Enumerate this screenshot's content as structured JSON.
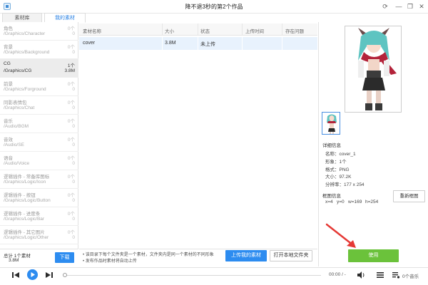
{
  "window": {
    "title": "降不退3秒的第2个作品"
  },
  "tabs": [
    {
      "label": "素材库"
    },
    {
      "label": "我的素材"
    }
  ],
  "categories": [
    {
      "name": "角色",
      "path": "/Graphics/Character",
      "count": "0个",
      "size": "0"
    },
    {
      "name": "背景",
      "path": "/Graphics/Background",
      "count": "0个",
      "size": "0"
    },
    {
      "name": "CG",
      "path": "/Graphics/CG",
      "count": "1个",
      "size": "3.8M"
    },
    {
      "name": "前景",
      "path": "/Graphics/Forground",
      "count": "0个",
      "size": "0"
    },
    {
      "name": "同影表情包",
      "path": "/Graphics/Chat",
      "count": "0个",
      "size": "0"
    },
    {
      "name": "音乐",
      "path": "/Audio/BGM",
      "count": "0个",
      "size": "0"
    },
    {
      "name": "音效",
      "path": "/Audio/SE",
      "count": "0个",
      "size": "0"
    },
    {
      "name": "语音",
      "path": "/Audio/Voice",
      "count": "0个",
      "size": "0"
    },
    {
      "name": "逻辑插件 - 常备库图标",
      "path": "/Graphics/Logic/Icon",
      "count": "0个",
      "size": "0"
    },
    {
      "name": "逻辑插件 - 按钮",
      "path": "/Graphics/Logic/Button",
      "count": "0个",
      "size": "0"
    },
    {
      "name": "逻辑插件 - 进度条",
      "path": "/Graphics/Logic/Bar",
      "count": "0个",
      "size": "0"
    },
    {
      "name": "逻辑插件 - 其它图片",
      "path": "/Graphics/Logic/Other",
      "count": "0个",
      "size": "0"
    }
  ],
  "left_footer": {
    "total_label": "总计   1个素材",
    "total_size": "3.8M",
    "download_label": "下载"
  },
  "table": {
    "headers": [
      "素材名称",
      "大小",
      "状态",
      "上传时间",
      "存在问题"
    ],
    "rows": [
      {
        "name": "cover",
        "size": "3.8M",
        "status": "未上传",
        "time": "",
        "issue": ""
      }
    ]
  },
  "notice": {
    "line1": "• 该目录下每个文件夹是一个素材，文件夹内是同一个素材的不同形象",
    "line2": "• 发布作品时素材将自动上传"
  },
  "buttons": {
    "upload": "上传我的素材",
    "open_folder": "打开本地文件夹",
    "recrop": "重新框图",
    "use": "使用"
  },
  "details": {
    "title": "详细信息",
    "items": [
      {
        "label": "名称：",
        "value": "cover_1"
      },
      {
        "label": "形象：",
        "value": "1个"
      },
      {
        "label": "格式：",
        "value": "PNG"
      },
      {
        "label": "大小：",
        "value": "97.2K"
      },
      {
        "label": "分辨率：",
        "value": "177 x 254"
      }
    ]
  },
  "crop": {
    "title": "框图信息",
    "x": "x=4",
    "y": "y=0",
    "w": "w=169",
    "h": "h=254"
  },
  "player": {
    "time": "00:00 / -",
    "music_count": "0个音乐"
  },
  "colors": {
    "accent": "#2d8cf0",
    "use_button": "#6bc23b",
    "arrow": "#e53935"
  }
}
